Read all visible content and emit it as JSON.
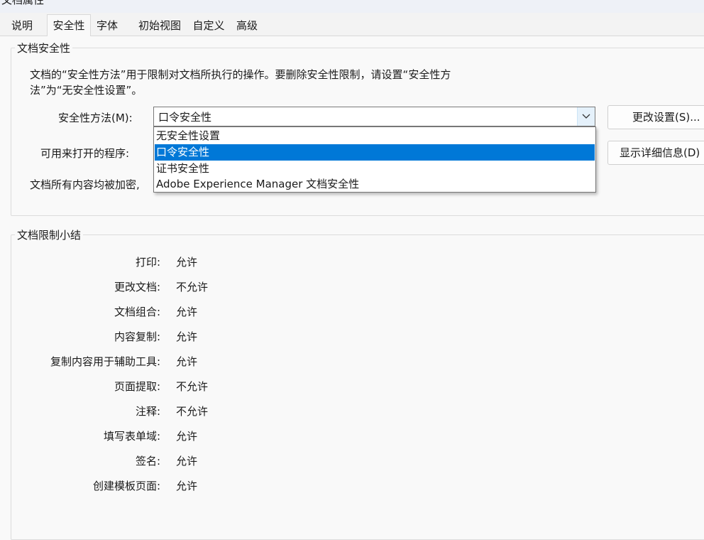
{
  "window": {
    "title": "文档属性"
  },
  "tabs": [
    {
      "label": "说明"
    },
    {
      "label": "安全性"
    },
    {
      "label": "字体"
    },
    {
      "label": "初始视图"
    },
    {
      "label": "自定义"
    },
    {
      "label": "高级"
    }
  ],
  "active_tab": "安全性",
  "security": {
    "group_title": "文档安全性",
    "description": "文档的“安全性方法”用于限制对文档所执行的操作。要删除安全性限制，请设置“安全性方法”为“无安全性设置”。",
    "method_label": "安全性方法(M):",
    "method_value": "口令安全性",
    "change_settings_button": "更改设置(S)...",
    "open_with_label": "可用来打开的程序:",
    "show_details_button": "显示详细信息(D)",
    "encrypted_text": "文档所有内容均被加密,",
    "dropdown_options": [
      {
        "label": "无安全性设置",
        "selected": false
      },
      {
        "label": "口令安全性",
        "selected": true
      },
      {
        "label": "证书安全性",
        "selected": false
      },
      {
        "label": "Adobe Experience Manager 文档安全性",
        "selected": false
      }
    ]
  },
  "restrictions": {
    "group_title": "文档限制小结",
    "items": [
      {
        "label": "打印:",
        "value": "允许"
      },
      {
        "label": "更改文档:",
        "value": "不允许"
      },
      {
        "label": "文档组合:",
        "value": "允许"
      },
      {
        "label": "内容复制:",
        "value": "允许"
      },
      {
        "label": "复制内容用于辅助工具:",
        "value": "允许"
      },
      {
        "label": "页面提取:",
        "value": "不允许"
      },
      {
        "label": "注释:",
        "value": "不允许"
      },
      {
        "label": "填写表单域:",
        "value": "允许"
      },
      {
        "label": "签名:",
        "value": "允许"
      },
      {
        "label": "创建模板页面:",
        "value": "允许"
      }
    ]
  },
  "colors": {
    "selection": "#0078d7",
    "background": "#f9f9f9"
  }
}
